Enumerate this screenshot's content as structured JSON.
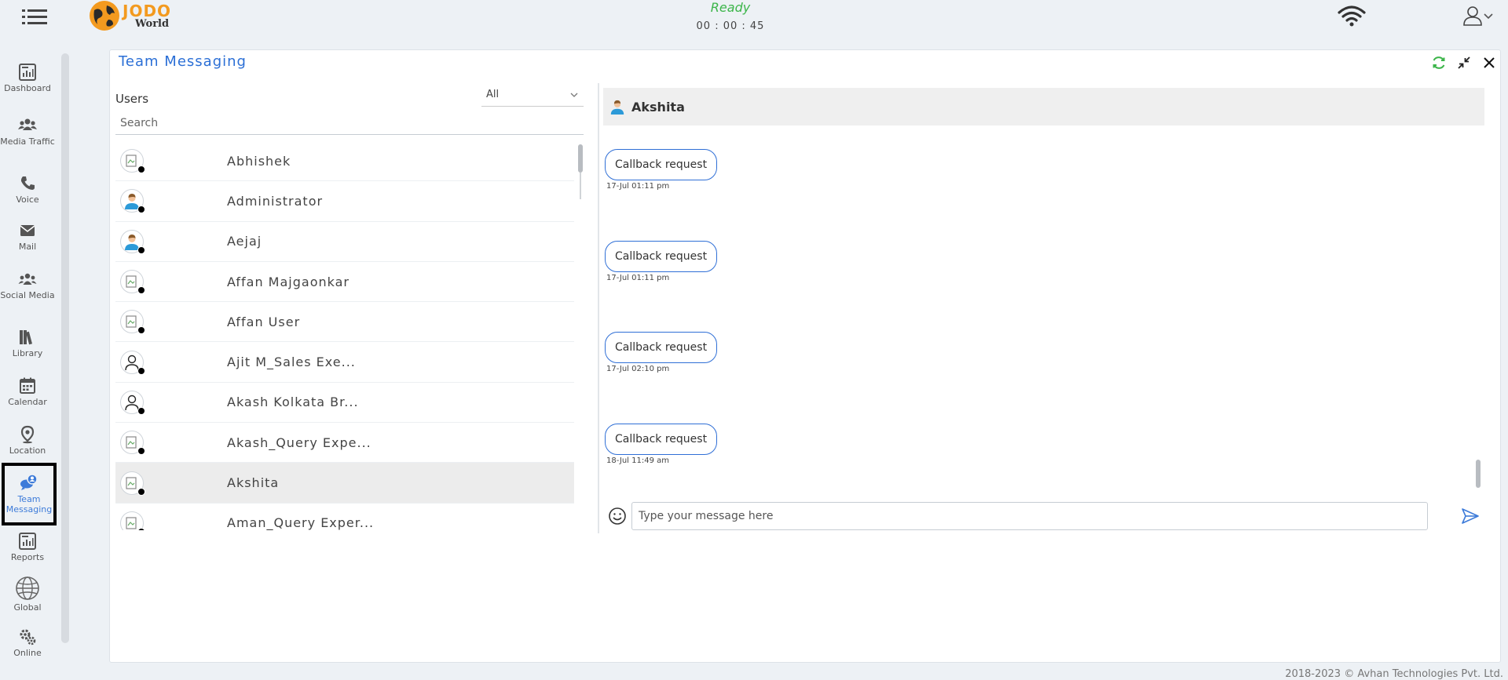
{
  "topbar": {
    "logo_primary": "JODO",
    "logo_secondary": "World",
    "status": "Ready",
    "timer": "00 : 00 : 45"
  },
  "sidebar": {
    "items": [
      {
        "label": "Dashboard",
        "icon": "dashboard-icon"
      },
      {
        "label": "Media Traffic",
        "icon": "media-traffic-icon"
      },
      {
        "label": "Voice",
        "icon": "phone-icon"
      },
      {
        "label": "Mail",
        "icon": "mail-icon"
      },
      {
        "label": "Social Media",
        "icon": "social-media-icon"
      },
      {
        "label": "Library",
        "icon": "library-icon"
      },
      {
        "label": "Calendar",
        "icon": "calendar-icon"
      },
      {
        "label": "Location",
        "icon": "location-icon"
      },
      {
        "label": "Team Messaging",
        "icon": "team-messaging-icon",
        "active": true
      },
      {
        "label": "Reports",
        "icon": "reports-icon"
      },
      {
        "label": "Global",
        "icon": "globe-icon"
      },
      {
        "label": "Online",
        "icon": "gears-icon"
      }
    ]
  },
  "panel": {
    "title": "Team Messaging"
  },
  "users": {
    "label": "Users",
    "filter_value": "All",
    "search_placeholder": "Search",
    "list": [
      {
        "name": "Abhishek",
        "avatar": "broken-image"
      },
      {
        "name": "Administrator",
        "avatar": "person"
      },
      {
        "name": "Aejaj",
        "avatar": "person"
      },
      {
        "name": "Affan Majgaonkar",
        "avatar": "broken-image"
      },
      {
        "name": "Affan User",
        "avatar": "broken-image"
      },
      {
        "name": "Ajit M_Sales Exe...",
        "avatar": "outline"
      },
      {
        "name": "Akash Kolkata Br...",
        "avatar": "outline"
      },
      {
        "name": "Akash_Query Expe...",
        "avatar": "broken-image"
      },
      {
        "name": "Akshita",
        "avatar": "broken-image",
        "selected": true
      },
      {
        "name": "Aman_Query Exper...",
        "avatar": "broken-image"
      }
    ]
  },
  "chat": {
    "contact_name": "Akshita",
    "messages": [
      {
        "text": "Callback request",
        "time": "17-Jul 01:11 pm"
      },
      {
        "text": "Callback request",
        "time": "17-Jul 01:11 pm"
      },
      {
        "text": "Callback request",
        "time": "17-Jul 02:10 pm"
      },
      {
        "text": "Callback request",
        "time": "18-Jul 11:49 am"
      }
    ],
    "input_placeholder": "Type your message here"
  },
  "footer": {
    "copyright": "2018-2023 © Avhan Technologies Pvt. Ltd."
  },
  "colors": {
    "accent": "#2b6fd6",
    "status_ready": "#3cb54a",
    "logo_orange": "#f39a1f",
    "refresh": "#3cb54a"
  }
}
